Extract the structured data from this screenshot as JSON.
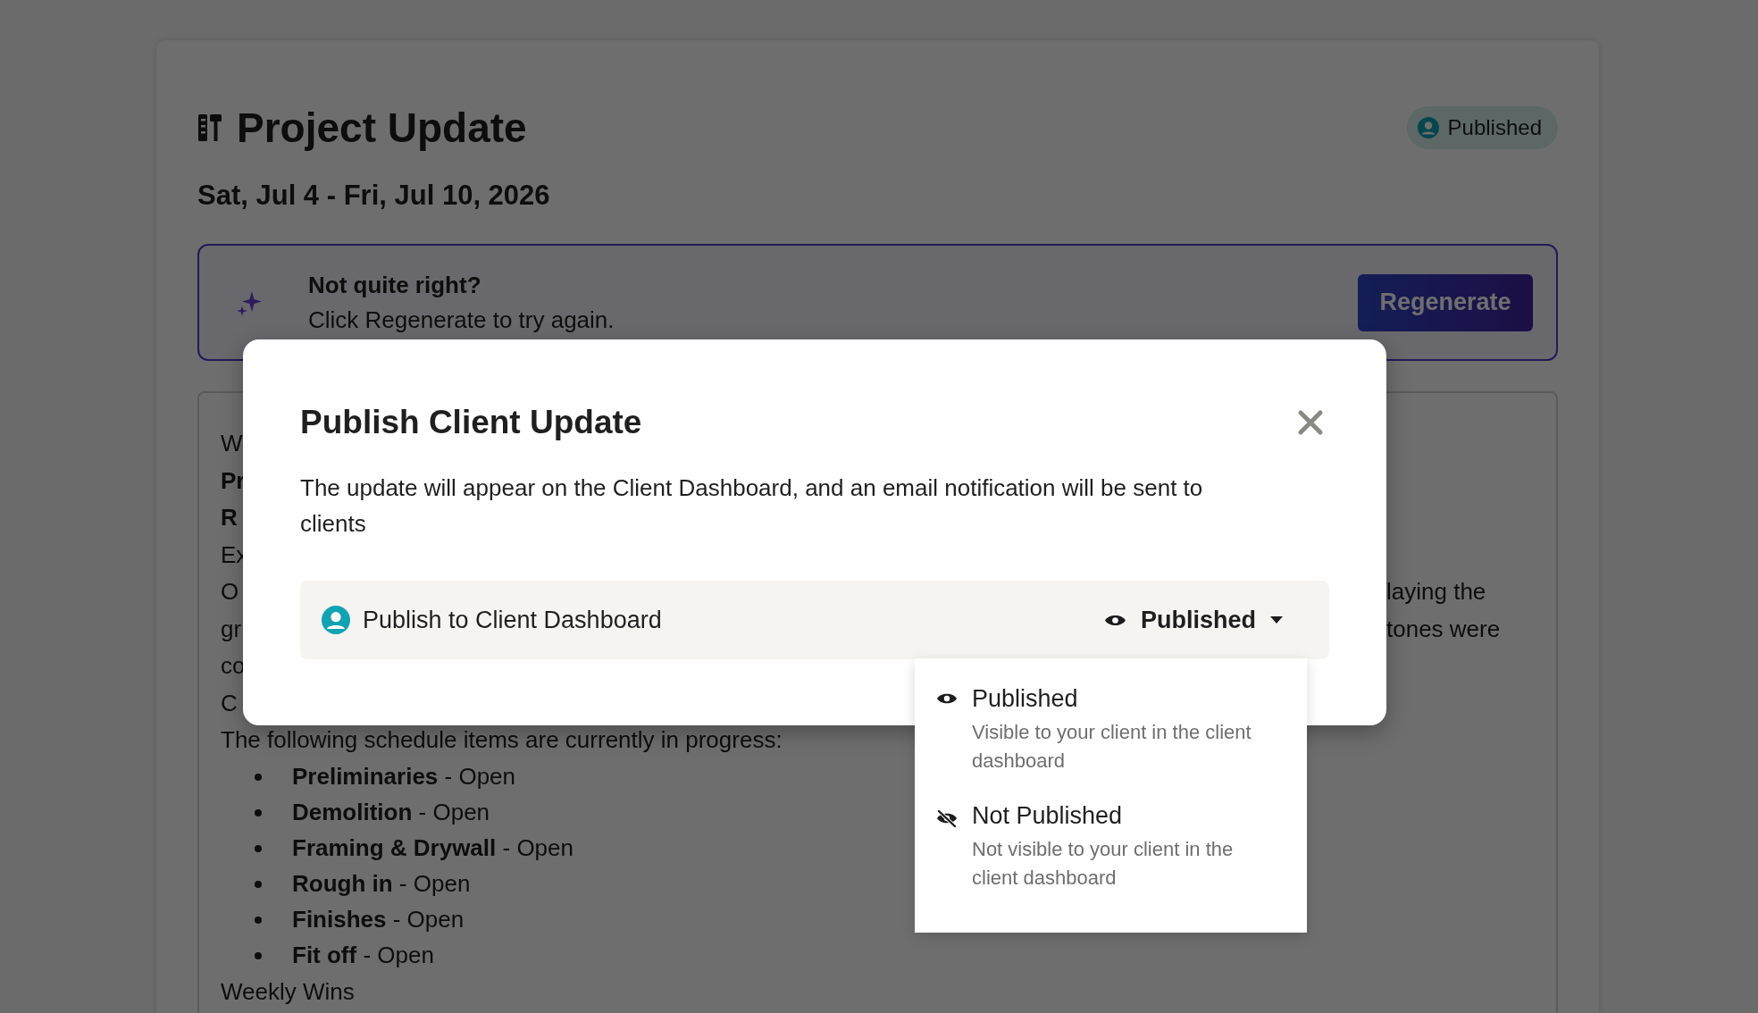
{
  "header": {
    "title": "Project Update",
    "status_badge": "Published"
  },
  "date_range": "Sat, Jul 4 - Fri, Jul 10, 2026",
  "banner": {
    "heading": "Not quite right?",
    "message": "Click Regenerate to try again.",
    "button": "Regenerate"
  },
  "content": {
    "lines": [
      {
        "text": "W",
        "bold": false
      },
      {
        "text": "Pr",
        "bold": true
      },
      {
        "text": "R",
        "bold": true
      },
      {
        "text": "Ex",
        "bold": false
      },
      {
        "text": "O",
        "bold": false,
        "right_text": "laying the"
      },
      {
        "text": "gr",
        "bold": false,
        "right_text": "tones were"
      },
      {
        "text": "co",
        "bold": false
      },
      {
        "text": "C",
        "bold": false
      },
      {
        "text": "The following schedule items are currently in progress:",
        "bold": false
      }
    ],
    "bullets": [
      {
        "name": "Preliminaries",
        "status": "- Open"
      },
      {
        "name": "Demolition",
        "status": "- Open"
      },
      {
        "name": "Framing & Drywall",
        "status": "- Open"
      },
      {
        "name": "Rough in",
        "status": "- Open"
      },
      {
        "name": "Finishes",
        "status": "- Open"
      },
      {
        "name": "Fit off",
        "status": "- Open"
      }
    ],
    "footer_line": "Weekly Wins"
  },
  "modal": {
    "title": "Publish Client Update",
    "description": "The update will appear on the Client Dashboard, and an email notification will be sent to clients",
    "setting": {
      "label": "Publish to Client Dashboard",
      "value": "Published"
    },
    "dropdown": {
      "options": [
        {
          "kind": "visible",
          "label": "Published",
          "description": "Visible to your client in the client dashboard"
        },
        {
          "kind": "hidden",
          "label": "Not Published",
          "description": "Not visible to your client in the client dashboard"
        }
      ]
    }
  }
}
